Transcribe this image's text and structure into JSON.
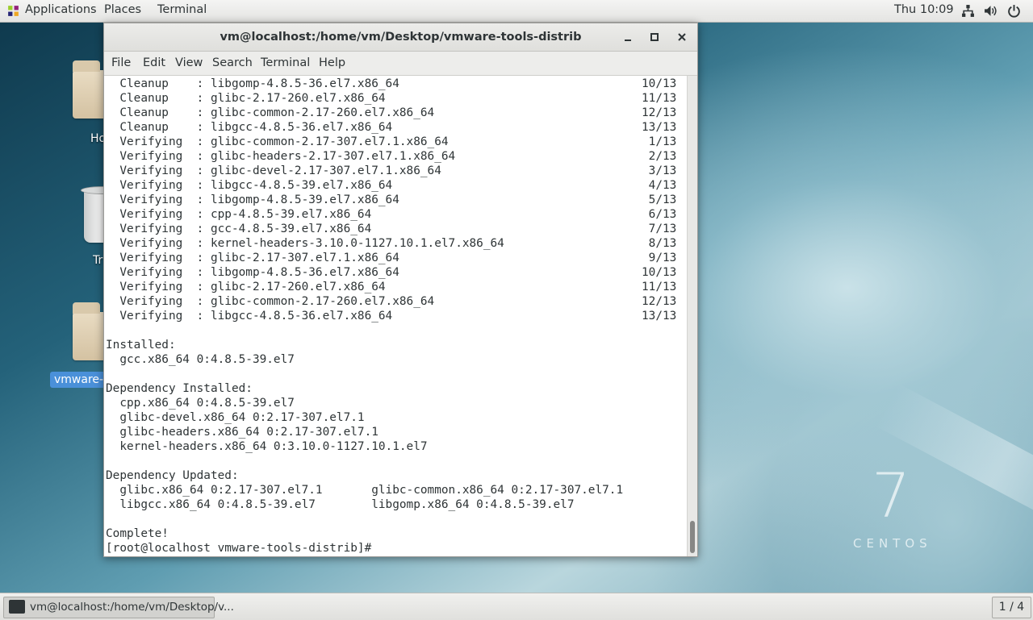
{
  "topbar": {
    "applications": "Applications",
    "places": "Places",
    "terminal": "Terminal",
    "clock": "Thu 10:09",
    "icons": [
      "network-icon",
      "volume-icon",
      "power-icon"
    ]
  },
  "desktop": {
    "icons": [
      {
        "label": "Ho",
        "icon": "home-folder-icon"
      },
      {
        "label": "Tr",
        "icon": "trash-icon"
      },
      {
        "label": "vmware-t",
        "icon": "folder-icon",
        "selected": true
      }
    ],
    "branding": {
      "numeral": "7",
      "word": "CENTOS"
    }
  },
  "window": {
    "title": "vm@localhost:/home/vm/Desktop/vmware-tools-distrib",
    "menu": [
      "File",
      "Edit",
      "View",
      "Search",
      "Terminal",
      "Help"
    ],
    "lines": [
      {
        "text": "  Cleanup    : libgomp-4.8.5-36.el7.x86_64",
        "right": "10/13"
      },
      {
        "text": "  Cleanup    : glibc-2.17-260.el7.x86_64",
        "right": "11/13"
      },
      {
        "text": "  Cleanup    : glibc-common-2.17-260.el7.x86_64",
        "right": "12/13"
      },
      {
        "text": "  Cleanup    : libgcc-4.8.5-36.el7.x86_64",
        "right": "13/13"
      },
      {
        "text": "  Verifying  : glibc-common-2.17-307.el7.1.x86_64",
        "right": " 1/13"
      },
      {
        "text": "  Verifying  : glibc-headers-2.17-307.el7.1.x86_64",
        "right": " 2/13"
      },
      {
        "text": "  Verifying  : glibc-devel-2.17-307.el7.1.x86_64",
        "right": " 3/13"
      },
      {
        "text": "  Verifying  : libgcc-4.8.5-39.el7.x86_64",
        "right": " 4/13"
      },
      {
        "text": "  Verifying  : libgomp-4.8.5-39.el7.x86_64",
        "right": " 5/13"
      },
      {
        "text": "  Verifying  : cpp-4.8.5-39.el7.x86_64",
        "right": " 6/13"
      },
      {
        "text": "  Verifying  : gcc-4.8.5-39.el7.x86_64",
        "right": " 7/13"
      },
      {
        "text": "  Verifying  : kernel-headers-3.10.0-1127.10.1.el7.x86_64",
        "right": " 8/13"
      },
      {
        "text": "  Verifying  : glibc-2.17-307.el7.1.x86_64",
        "right": " 9/13"
      },
      {
        "text": "  Verifying  : libgomp-4.8.5-36.el7.x86_64",
        "right": "10/13"
      },
      {
        "text": "  Verifying  : glibc-2.17-260.el7.x86_64",
        "right": "11/13"
      },
      {
        "text": "  Verifying  : glibc-common-2.17-260.el7.x86_64",
        "right": "12/13"
      },
      {
        "text": "  Verifying  : libgcc-4.8.5-36.el7.x86_64",
        "right": "13/13"
      },
      {
        "text": "",
        "right": ""
      },
      {
        "text": "Installed:",
        "right": ""
      },
      {
        "text": "  gcc.x86_64 0:4.8.5-39.el7",
        "right": ""
      },
      {
        "text": "",
        "right": ""
      },
      {
        "text": "Dependency Installed:",
        "right": ""
      },
      {
        "text": "  cpp.x86_64 0:4.8.5-39.el7",
        "right": ""
      },
      {
        "text": "  glibc-devel.x86_64 0:2.17-307.el7.1",
        "right": ""
      },
      {
        "text": "  glibc-headers.x86_64 0:2.17-307.el7.1",
        "right": ""
      },
      {
        "text": "  kernel-headers.x86_64 0:3.10.0-1127.10.1.el7",
        "right": ""
      },
      {
        "text": "",
        "right": ""
      },
      {
        "text": "Dependency Updated:",
        "right": ""
      },
      {
        "text": "  glibc.x86_64 0:2.17-307.el7.1       glibc-common.x86_64 0:2.17-307.el7.1",
        "right": ""
      },
      {
        "text": "  libgcc.x86_64 0:4.8.5-39.el7        libgomp.x86_64 0:4.8.5-39.el7",
        "right": ""
      },
      {
        "text": "",
        "right": ""
      },
      {
        "text": "Complete!",
        "right": ""
      },
      {
        "text": "[root@localhost vmware-tools-distrib]# ",
        "right": ""
      }
    ]
  },
  "taskbar": {
    "task_label": "vm@localhost:/home/vm/Desktop/v...",
    "workspace": "1 / 4"
  }
}
